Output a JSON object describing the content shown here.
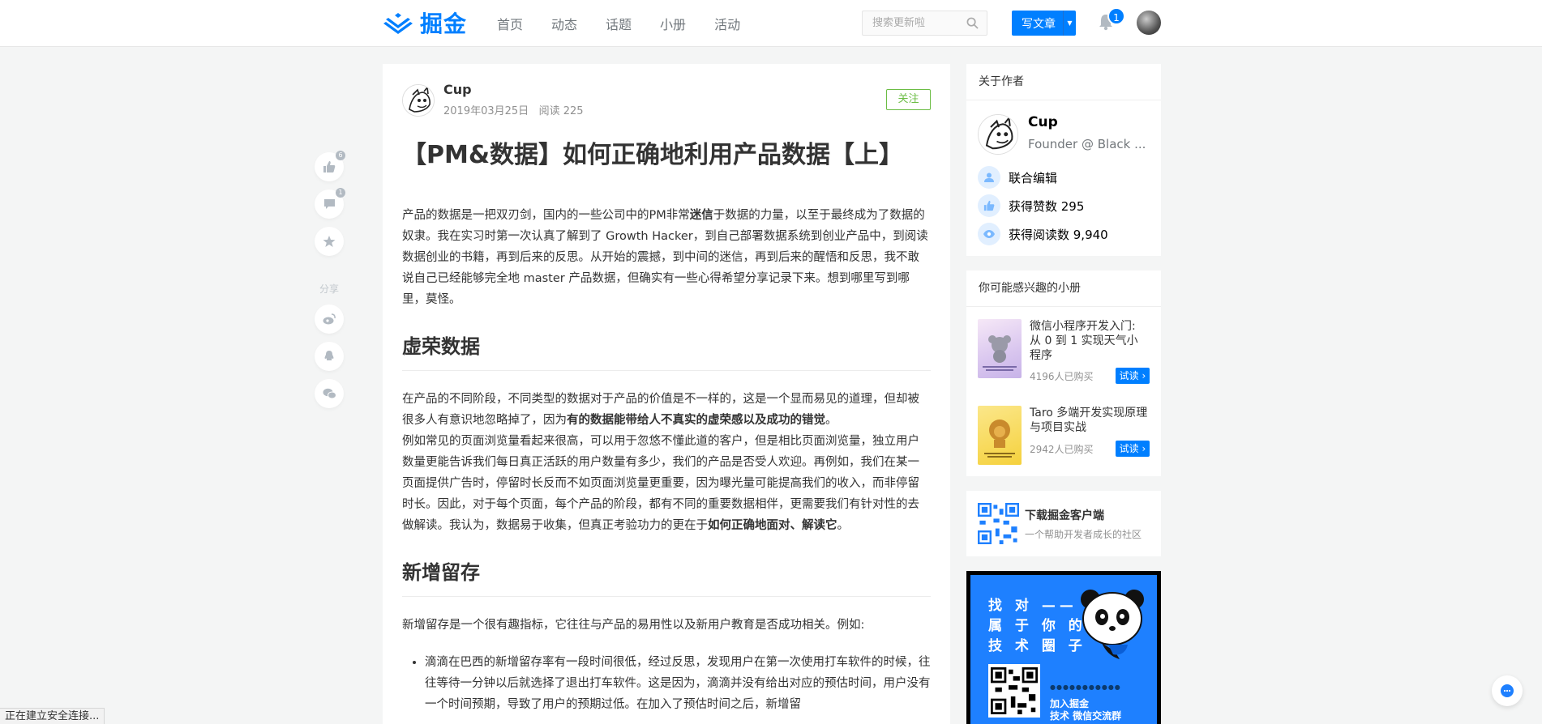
{
  "header": {
    "logo_text": "掘金",
    "nav": [
      "首页",
      "动态",
      "话题",
      "小册",
      "活动"
    ],
    "search_placeholder": "搜索更新啦",
    "write_label": "写文章",
    "notification_count": "1",
    "brand_color": "#007fff"
  },
  "float_actions": {
    "like_count": "6",
    "comment_count": "1",
    "share_label": "分享",
    "icons": [
      "thumbs-up-icon",
      "comment-icon",
      "star-icon",
      "weibo-icon",
      "qq-icon",
      "wechat-icon"
    ]
  },
  "article": {
    "author": "Cup",
    "date": "2019年03月25日",
    "reads": "阅读 225",
    "follow_label": "关注",
    "title": "【PM&数据】如何正确地利用产品数据【上】",
    "p1_a": "产品的数据是一把双刃剑，国内的一些公司中的PM非常",
    "p1_b": "迷信",
    "p1_c": "于数据的力量，以至于最终成为了数据的奴隶。我在实习时第一次认真了解到了 Growth Hacker，到自己部署数据系统到创业产品中，到阅读数据创业的书籍，再到后来的反思。从开始的震撼，到中间的迷信，再到后来的醒悟和反思，我不敢说自己已经能够完全地 master 产品数据，但确实有一些心得希望分享记录下来。想到哪里写到哪里，莫怪。",
    "h2_1": "虚荣数据",
    "p2_a": "在产品的不同阶段，不同类型的数据对于产品的价值是不一样的，这是一个显而易见的道理，但却被很多人有意识地忽略掉了，因为",
    "p2_b": "有的数据能带给人不真实的虚荣感以及成功的错觉",
    "p2_c": "。",
    "p3_a": "例如常见的页面浏览量看起来很高，可以用于忽悠不懂此道的客户，但是相比页面浏览量，独立用户数量更能告诉我们每日真正活跃的用户数量有多少，我们的产品是否受人欢迎。再例如，我们在某一页面提供广告时，停留时长反而不如页面浏览量更重要，因为曝光量可能提高我们的收入，而非停留时长。因此，对于每个页面，每个产品的阶段，都有不同的重要数据相伴，更需要我们有针对性的去做解读。我认为，数据易于收集，但真正考验功力的更在于",
    "p3_b": "如何正确地面对、解读它",
    "p3_c": "。",
    "h2_2": "新增留存",
    "p4": "新增留存是一个很有趣指标，它往往与产品的易用性以及新用户教育是否成功相关。例如:",
    "li1": "滴滴在巴西的新增留存率有一段时间很低，经过反思，发现用户在第一次使用打车软件的时候，往往等待一分钟以后就选择了退出打车软件。这是因为，滴滴并没有给出对应的预估时间，用户没有一个时间预期，导致了用户的预期过低。在加入了预估时间之后，新增留"
  },
  "sidebar": {
    "about_title": "关于作者",
    "author_name": "Cup",
    "author_job": "Founder @ Black ...",
    "stats": [
      "联合编辑",
      "获得赞数 295",
      "获得阅读数 9,940"
    ],
    "books_title": "你可能感兴趣的小册",
    "books": [
      {
        "title": "微信小程序开发入门: 从 0 到 1 实现天气小程序",
        "buyers": "4196人已购买",
        "try": "试读"
      },
      {
        "title": "Taro 多端开发实现原理与项目实战",
        "buyers": "2942人已购买",
        "try": "试读"
      }
    ],
    "app_title": "下载掘金客户端",
    "app_sub": "一个帮助开发者成长的社区",
    "promo_lines": [
      "找 对 ——",
      "属 于 你 的",
      "技 术 圈 子"
    ],
    "promo_cta": [
      "加入掘金",
      "技术 微信交流群"
    ]
  },
  "status_text": "正在建立安全连接..."
}
